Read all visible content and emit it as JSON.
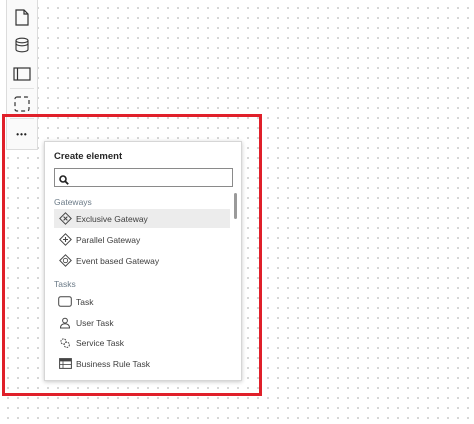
{
  "palette": {
    "items": [
      {
        "icon": "page-icon"
      },
      {
        "icon": "data-store-icon"
      },
      {
        "icon": "pool-icon"
      },
      {
        "icon": "group-icon"
      },
      {
        "icon": "more-icon"
      }
    ],
    "more_label": "•••"
  },
  "popup": {
    "title": "Create element",
    "search": {
      "value": "",
      "placeholder": ""
    },
    "groups": [
      {
        "title": "Gateways",
        "items": [
          {
            "label": "Exclusive Gateway",
            "icon": "exclusive-gateway-icon",
            "hovered": true
          },
          {
            "label": "Parallel Gateway",
            "icon": "parallel-gateway-icon"
          },
          {
            "label": "Event based Gateway",
            "icon": "event-based-gateway-icon"
          }
        ]
      },
      {
        "title": "Tasks",
        "items": [
          {
            "label": "Task",
            "icon": "task-icon"
          },
          {
            "label": "User Task",
            "icon": "user-task-icon"
          },
          {
            "label": "Service Task",
            "icon": "service-task-icon"
          },
          {
            "label": "Business Rule Task",
            "icon": "business-rule-task-icon"
          }
        ]
      }
    ]
  },
  "colors": {
    "highlight": "#e0202a",
    "hover": "#ececec",
    "group_title": "#6b7a87"
  }
}
